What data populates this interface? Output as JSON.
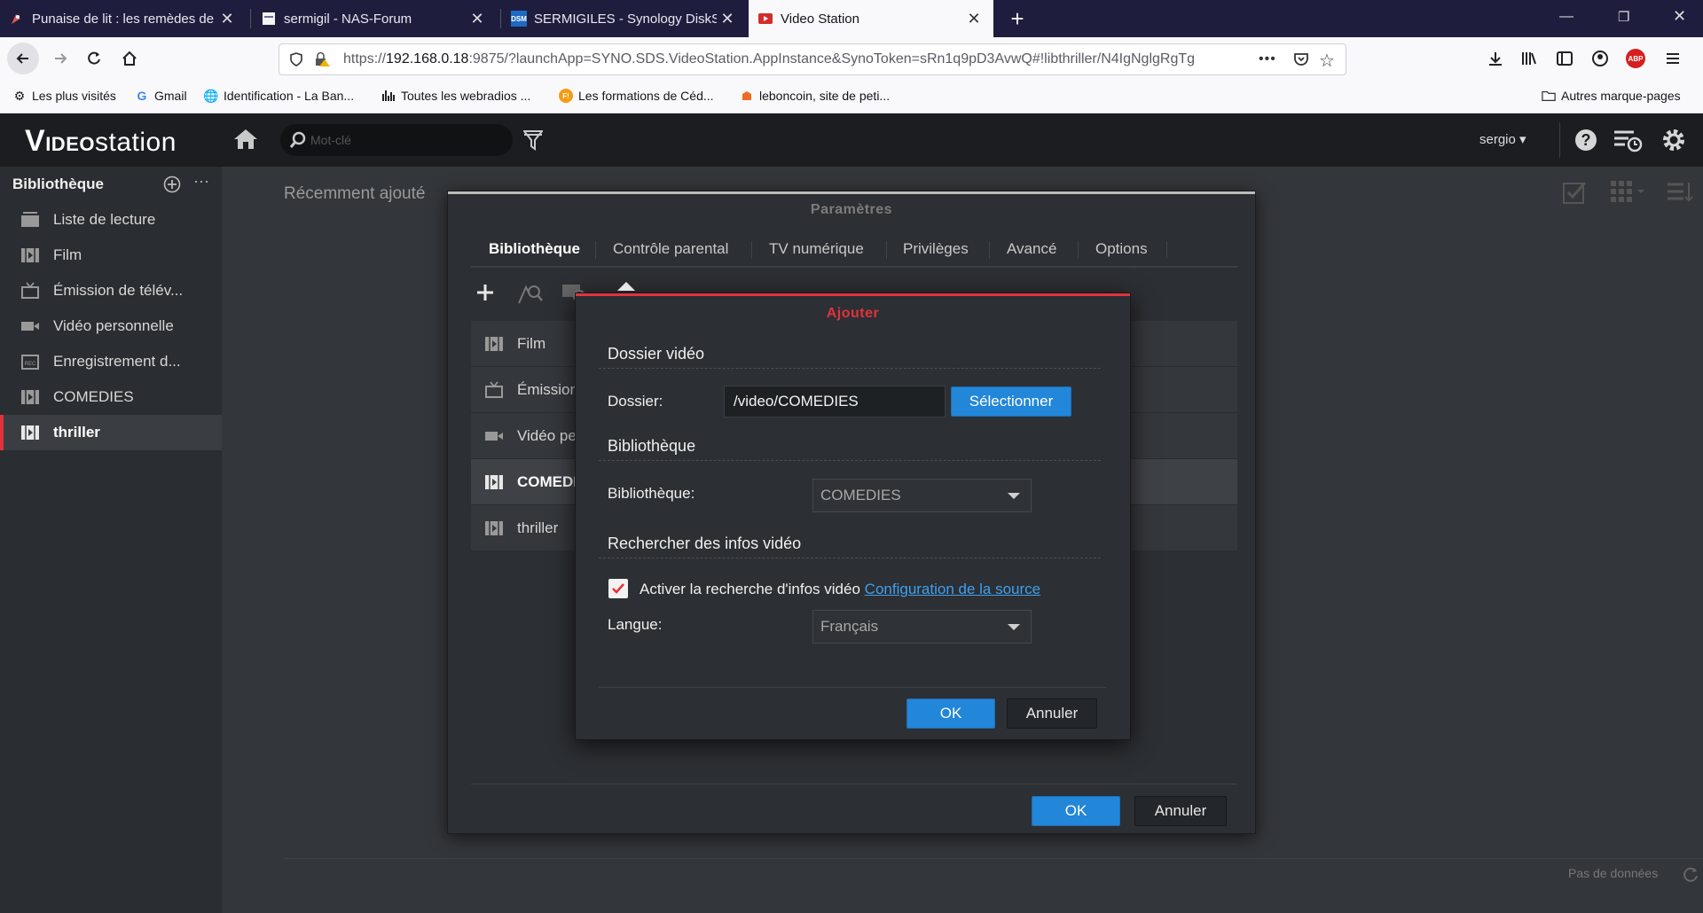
{
  "browser": {
    "tabs": [
      {
        "title": "Punaise de lit : les remèdes de g",
        "icon": "rocket-icon"
      },
      {
        "title": "sermigil - NAS-Forum",
        "icon": "page-icon"
      },
      {
        "title": "SERMIGILES - Synology DiskSta",
        "icon": "dsm-icon",
        "badge": "DSM"
      },
      {
        "title": "Video Station",
        "icon": "videostation-icon"
      }
    ],
    "url_prefix": "https://",
    "url_host": "192.168.0.18",
    "url_rest": ":9875/?launchApp=SYNO.SDS.VideoStation.AppInstance&SynoToken=sRn1q9pD3AvwQ#!libthriller/N4IgNglgRgTg",
    "url_more": "•••",
    "bookmarks": [
      {
        "label": "Les plus visités"
      },
      {
        "label": "Gmail",
        "glyph": "G"
      },
      {
        "label": "Identification - La Ban..."
      },
      {
        "label": "Toutes les webradios ..."
      },
      {
        "label": "Les formations de Céd...",
        "glyph": "F!"
      },
      {
        "label": "leboncoin, site de peti..."
      }
    ],
    "other_bookmarks": "Autres marque-pages",
    "abp": "ABP"
  },
  "app": {
    "logo_v": "V",
    "logo_ideo": "IDEO",
    "logo_station": "station",
    "search_placeholder": "Mot-clé",
    "user": "sergio ▾",
    "colors": {
      "accent": "#e2333c",
      "primary": "#2286d9"
    }
  },
  "sidebar": {
    "title": "Bibliothèque",
    "items": [
      {
        "label": "Liste de lecture",
        "icon": "playlist-icon"
      },
      {
        "label": "Film",
        "icon": "film-icon"
      },
      {
        "label": "Émission de télév...",
        "icon": "tv-icon"
      },
      {
        "label": "Vidéo personnelle",
        "icon": "camera-icon"
      },
      {
        "label": "Enregistrement d...",
        "icon": "rec-icon"
      },
      {
        "label": "COMEDIES",
        "icon": "film-icon"
      },
      {
        "label": "thriller",
        "icon": "film-icon",
        "selected": true
      }
    ]
  },
  "main": {
    "section": "Récemment ajouté",
    "nodata": "Pas de données"
  },
  "params_dialog": {
    "title": "Paramètres",
    "tabs": [
      "Bibliothèque",
      "Contrôle parental",
      "TV numérique",
      "Privilèges",
      "Avancé",
      "Options"
    ],
    "rows": [
      {
        "label": "Film",
        "icon": "film-icon"
      },
      {
        "label": "Émission",
        "icon": "tv-icon"
      },
      {
        "label": "Vidéo pe",
        "icon": "camera-icon"
      },
      {
        "label": "COMEDI",
        "icon": "film-icon",
        "selected": true
      },
      {
        "label": "thriller",
        "icon": "film-icon"
      }
    ],
    "ok": "OK",
    "cancel": "Annuler"
  },
  "add_dialog": {
    "title": "Ajouter",
    "section_folder": "Dossier vidéo",
    "folder_label": "Dossier:",
    "folder_value": "/video/COMEDIES",
    "select_button": "Sélectionner",
    "section_library": "Bibliothèque",
    "library_label": "Bibliothèque:",
    "library_value": "COMEDIES",
    "section_search": "Rechercher des infos vidéo",
    "enable_search_label": "Activer la recherche d'infos vidéo",
    "enable_search_checked": true,
    "source_config_link": "Configuration de la source",
    "language_label": "Langue:",
    "language_value": "Français",
    "ok": "OK",
    "cancel": "Annuler"
  }
}
